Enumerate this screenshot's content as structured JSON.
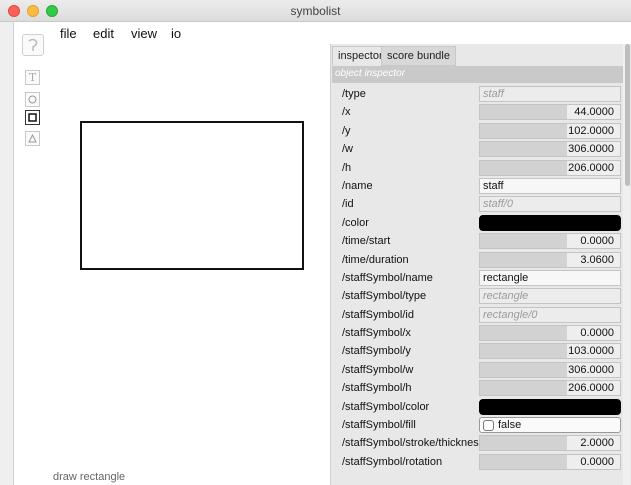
{
  "window": {
    "title": "symbolist"
  },
  "menu": [
    "file",
    "edit",
    "view",
    "io"
  ],
  "tools": [
    {
      "name": "glyph-tool",
      "icon": "curve-glyph-icon"
    },
    {
      "name": "text-tool",
      "icon": "text-t-icon"
    },
    {
      "name": "circle-tool",
      "icon": "circle-icon"
    },
    {
      "name": "rectangle-tool",
      "icon": "square-icon",
      "selected": true
    },
    {
      "name": "triangle-tool",
      "icon": "triangle-icon"
    }
  ],
  "status": "draw rectangle",
  "tabs": {
    "inspector": "inspector",
    "score_bundle": "score bundle"
  },
  "inspector_header": "object inspector",
  "props": {
    "type": {
      "label": "/type",
      "value": "staff"
    },
    "x": {
      "label": "/x",
      "value": "44.0000"
    },
    "y": {
      "label": "/y",
      "value": "102.0000"
    },
    "w": {
      "label": "/w",
      "value": "306.0000"
    },
    "h": {
      "label": "/h",
      "value": "206.0000"
    },
    "name": {
      "label": "/name",
      "value": "staff"
    },
    "id": {
      "label": "/id",
      "value": "staff/0"
    },
    "color": {
      "label": "/color",
      "value": "#000000"
    },
    "time_start": {
      "label": "/time/start",
      "value": "0.0000"
    },
    "time_duration": {
      "label": "/time/duration",
      "value": "3.0600"
    },
    "ss_name": {
      "label": "/staffSymbol/name",
      "value": "rectangle"
    },
    "ss_type": {
      "label": "/staffSymbol/type",
      "value": "rectangle"
    },
    "ss_id": {
      "label": "/staffSymbol/id",
      "value": "rectangle/0"
    },
    "ss_x": {
      "label": "/staffSymbol/x",
      "value": "0.0000"
    },
    "ss_y": {
      "label": "/staffSymbol/y",
      "value": "103.0000"
    },
    "ss_w": {
      "label": "/staffSymbol/w",
      "value": "306.0000"
    },
    "ss_h": {
      "label": "/staffSymbol/h",
      "value": "206.0000"
    },
    "ss_color": {
      "label": "/staffSymbol/color",
      "value": "#000000"
    },
    "ss_fill": {
      "label": "/staffSymbol/fill",
      "value": "false"
    },
    "ss_stroke": {
      "label": "/staffSymbol/stroke/thickness",
      "value": "2.0000"
    },
    "ss_rotation": {
      "label": "/staffSymbol/rotation",
      "value": "0.0000"
    }
  }
}
